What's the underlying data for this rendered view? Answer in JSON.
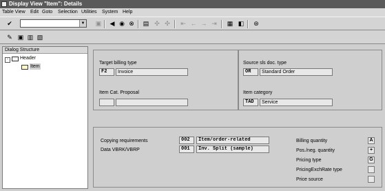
{
  "window": {
    "title": "Display View \"Item\": Details"
  },
  "menu": [
    "Table View",
    "Edit",
    "Goto",
    "Selection",
    "Utilities",
    "System",
    "Help"
  ],
  "toolbar": {
    "command_value": "",
    "icons": [
      "check-icon",
      "save-icon",
      "back-icon",
      "exit-icon",
      "cancel-icon",
      "print-icon",
      "find-icon",
      "find-next-icon",
      "first-page-icon",
      "previous-page-icon",
      "next-page-icon",
      "last-page-icon",
      "create-session-icon",
      "shortcut-icon",
      "help-icon"
    ],
    "app_icons": [
      "change-display-icon",
      "save-icon",
      "new-entries-icon",
      "copy-icon"
    ]
  },
  "tree": {
    "header": "Dialog Structure",
    "nodes": [
      {
        "label": "Header",
        "toggle": "-"
      },
      {
        "label": "Item"
      }
    ]
  },
  "target": {
    "billing_type_label": "Target billing type",
    "billing_type_code": "F2",
    "billing_type_text": "Invoice",
    "item_cat_proposal_label": "Item Cat. Proposal",
    "item_cat_proposal_code": "",
    "item_cat_proposal_text": ""
  },
  "source": {
    "doc_type_label": "Source sls doc. type",
    "doc_type_code": "OR",
    "doc_type_text": "Standard Order",
    "item_category_label": "Item category",
    "item_category_code": "TAD",
    "item_category_text": "Service"
  },
  "copy_control": {
    "copying_req_label": "Copying requirements",
    "copying_req_code": "002",
    "copying_req_text": "Item/order-related",
    "data_vbrk_label": "Data VBRK/VBRP",
    "data_vbrk_code": "001",
    "data_vbrk_text": "Inv. Split (sample)"
  },
  "quantity": {
    "billing_quantity_label": "Billing quantity",
    "billing_quantity_value": "A",
    "pos_neg_label": "Pos./neg. quantity",
    "pos_neg_value": "+",
    "pricing_type_label": "Pricing type",
    "pricing_type_value": "G",
    "pricing_exch_label": "PricingExchRate type",
    "pricing_exch_value": "",
    "price_source_label": "Price source",
    "price_source_value": ""
  }
}
